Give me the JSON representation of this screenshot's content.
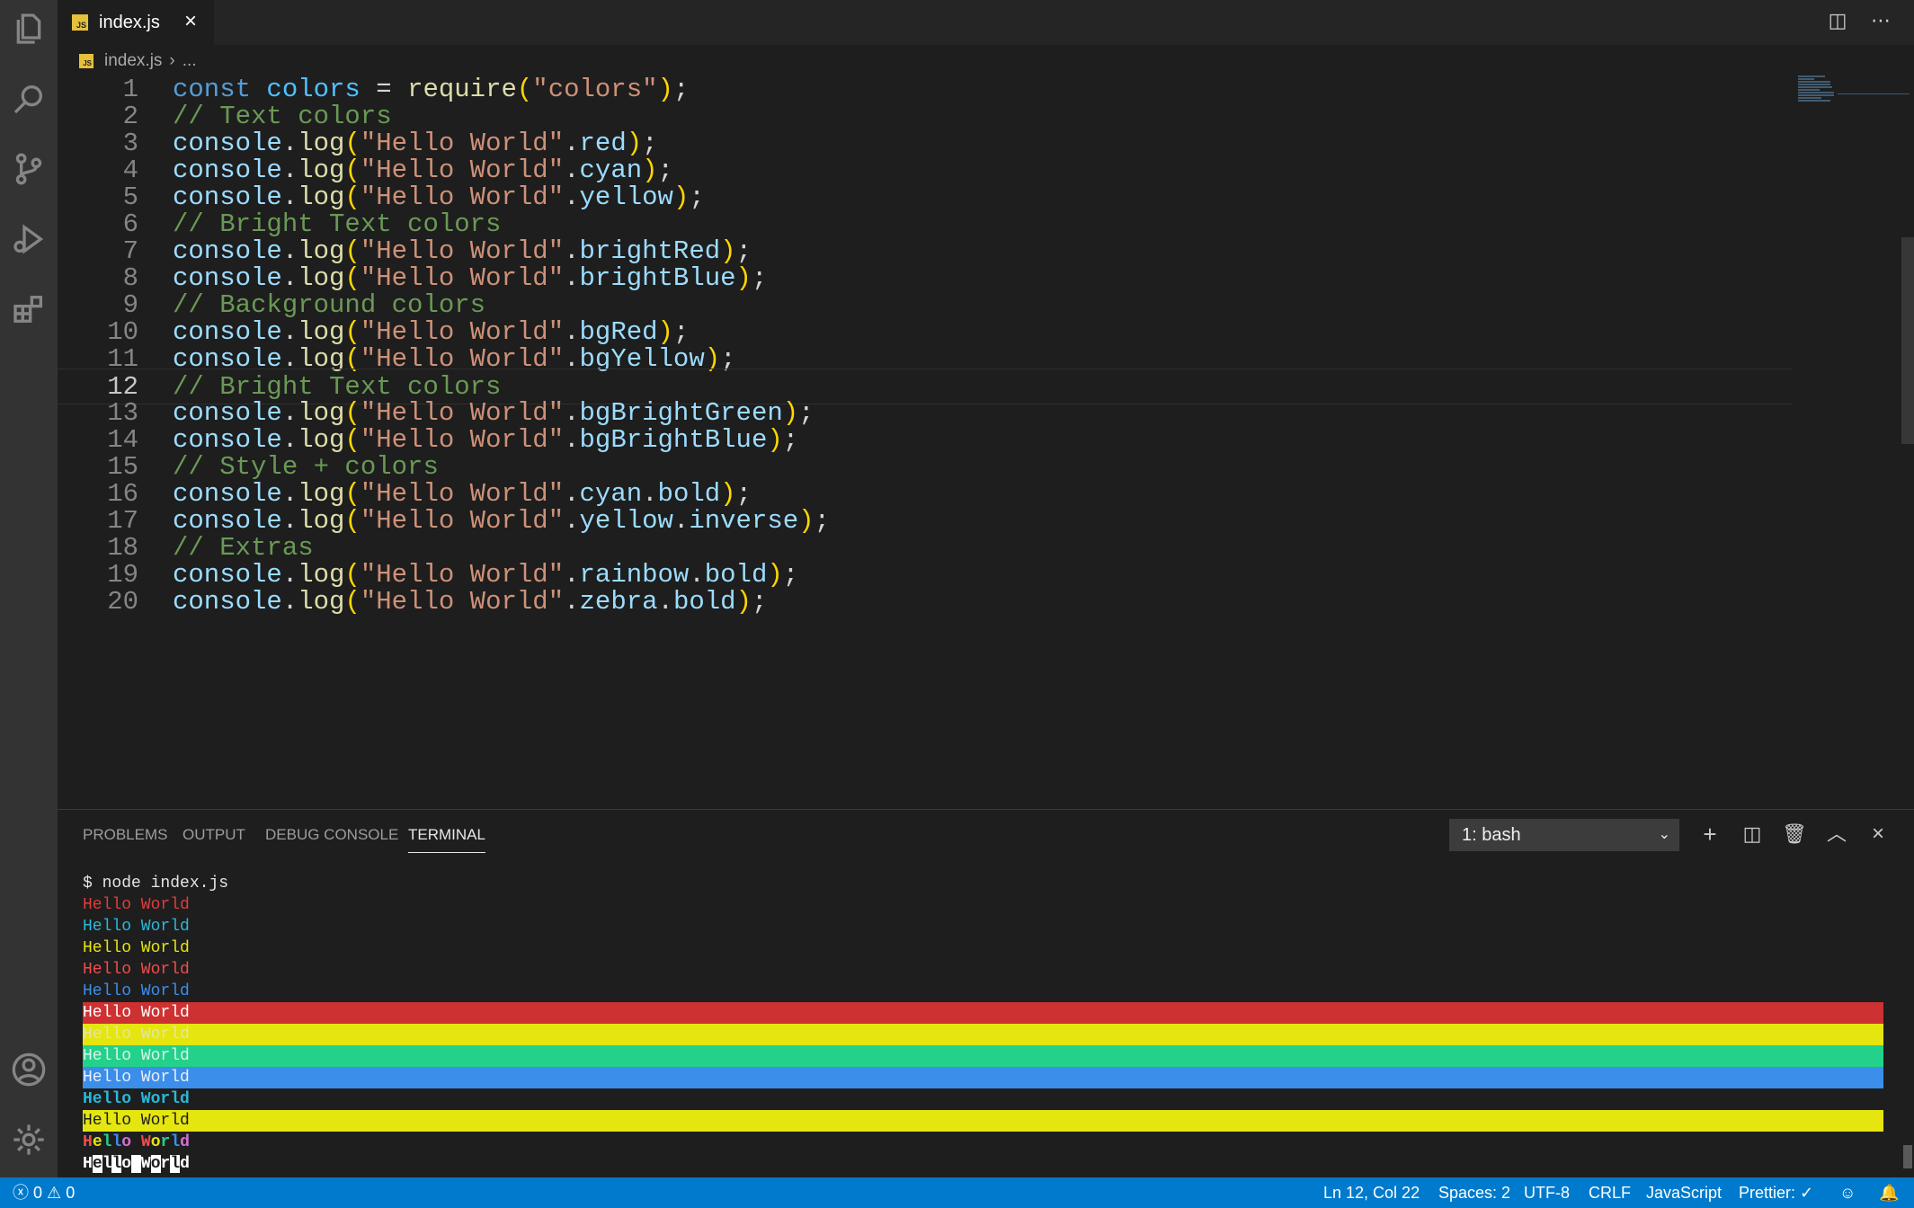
{
  "tabs": [
    {
      "label": "index.js",
      "icon": "js-file-icon"
    }
  ],
  "tab_badge": "JS",
  "breadcrumb": {
    "file": "index.js",
    "ellipsis": "..."
  },
  "editor": {
    "line_numbers": [
      "1",
      "2",
      "3",
      "4",
      "5",
      "6",
      "7",
      "8",
      "9",
      "10",
      "11",
      "12",
      "13",
      "14",
      "15",
      "16",
      "17",
      "18",
      "19",
      "20"
    ],
    "current_line": 12
  },
  "panel": {
    "tabs": [
      "PROBLEMS",
      "OUTPUT",
      "DEBUG CONSOLE",
      "TERMINAL"
    ],
    "active_tab": "TERMINAL",
    "shell": "1: bash"
  },
  "terminal": {
    "command": "$ node index.js",
    "output_text": "Hello World",
    "colors": {
      "red": "#e03c3c",
      "cyan": "#29b8db",
      "yellow": "#e5e510",
      "bright_red": "#f14c4c",
      "bright_blue": "#3b8eea",
      "bg_red": "#cd3131",
      "bg_yellow": "#e5e510",
      "bg_bright_green": "#23d18b",
      "bg_bright_blue": "#3b8eea"
    }
  },
  "status_bar": {
    "errors": "0",
    "warnings": "0",
    "position": "Ln 12, Col 22",
    "spaces": "Spaces: 2",
    "encoding": "UTF-8",
    "eol": "CRLF",
    "language": "JavaScript",
    "formatter": "Prettier: ✓"
  },
  "accent_color": "#007acc"
}
